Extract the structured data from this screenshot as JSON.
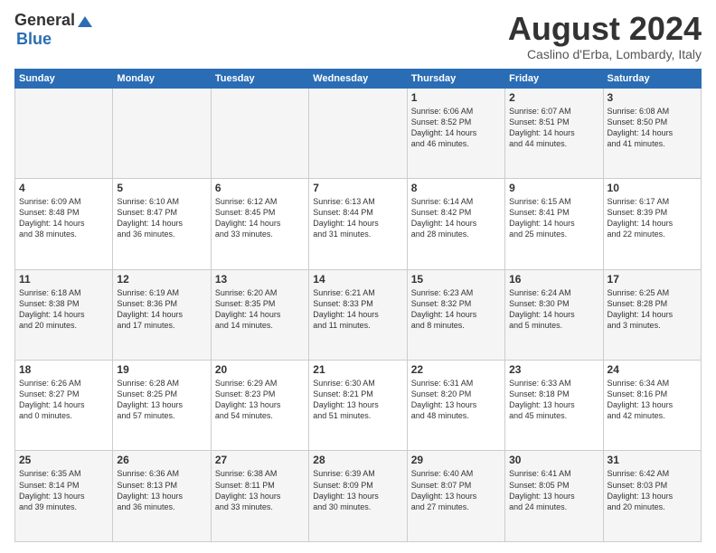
{
  "logo": {
    "general": "General",
    "blue": "Blue"
  },
  "header": {
    "month": "August 2024",
    "location": "Caslino d'Erba, Lombardy, Italy"
  },
  "days_of_week": [
    "Sunday",
    "Monday",
    "Tuesday",
    "Wednesday",
    "Thursday",
    "Friday",
    "Saturday"
  ],
  "weeks": [
    [
      {
        "day": "",
        "content": ""
      },
      {
        "day": "",
        "content": ""
      },
      {
        "day": "",
        "content": ""
      },
      {
        "day": "",
        "content": ""
      },
      {
        "day": "1",
        "content": "Sunrise: 6:06 AM\nSunset: 8:52 PM\nDaylight: 14 hours\nand 46 minutes."
      },
      {
        "day": "2",
        "content": "Sunrise: 6:07 AM\nSunset: 8:51 PM\nDaylight: 14 hours\nand 44 minutes."
      },
      {
        "day": "3",
        "content": "Sunrise: 6:08 AM\nSunset: 8:50 PM\nDaylight: 14 hours\nand 41 minutes."
      }
    ],
    [
      {
        "day": "4",
        "content": "Sunrise: 6:09 AM\nSunset: 8:48 PM\nDaylight: 14 hours\nand 38 minutes."
      },
      {
        "day": "5",
        "content": "Sunrise: 6:10 AM\nSunset: 8:47 PM\nDaylight: 14 hours\nand 36 minutes."
      },
      {
        "day": "6",
        "content": "Sunrise: 6:12 AM\nSunset: 8:45 PM\nDaylight: 14 hours\nand 33 minutes."
      },
      {
        "day": "7",
        "content": "Sunrise: 6:13 AM\nSunset: 8:44 PM\nDaylight: 14 hours\nand 31 minutes."
      },
      {
        "day": "8",
        "content": "Sunrise: 6:14 AM\nSunset: 8:42 PM\nDaylight: 14 hours\nand 28 minutes."
      },
      {
        "day": "9",
        "content": "Sunrise: 6:15 AM\nSunset: 8:41 PM\nDaylight: 14 hours\nand 25 minutes."
      },
      {
        "day": "10",
        "content": "Sunrise: 6:17 AM\nSunset: 8:39 PM\nDaylight: 14 hours\nand 22 minutes."
      }
    ],
    [
      {
        "day": "11",
        "content": "Sunrise: 6:18 AM\nSunset: 8:38 PM\nDaylight: 14 hours\nand 20 minutes."
      },
      {
        "day": "12",
        "content": "Sunrise: 6:19 AM\nSunset: 8:36 PM\nDaylight: 14 hours\nand 17 minutes."
      },
      {
        "day": "13",
        "content": "Sunrise: 6:20 AM\nSunset: 8:35 PM\nDaylight: 14 hours\nand 14 minutes."
      },
      {
        "day": "14",
        "content": "Sunrise: 6:21 AM\nSunset: 8:33 PM\nDaylight: 14 hours\nand 11 minutes."
      },
      {
        "day": "15",
        "content": "Sunrise: 6:23 AM\nSunset: 8:32 PM\nDaylight: 14 hours\nand 8 minutes."
      },
      {
        "day": "16",
        "content": "Sunrise: 6:24 AM\nSunset: 8:30 PM\nDaylight: 14 hours\nand 5 minutes."
      },
      {
        "day": "17",
        "content": "Sunrise: 6:25 AM\nSunset: 8:28 PM\nDaylight: 14 hours\nand 3 minutes."
      }
    ],
    [
      {
        "day": "18",
        "content": "Sunrise: 6:26 AM\nSunset: 8:27 PM\nDaylight: 14 hours\nand 0 minutes."
      },
      {
        "day": "19",
        "content": "Sunrise: 6:28 AM\nSunset: 8:25 PM\nDaylight: 13 hours\nand 57 minutes."
      },
      {
        "day": "20",
        "content": "Sunrise: 6:29 AM\nSunset: 8:23 PM\nDaylight: 13 hours\nand 54 minutes."
      },
      {
        "day": "21",
        "content": "Sunrise: 6:30 AM\nSunset: 8:21 PM\nDaylight: 13 hours\nand 51 minutes."
      },
      {
        "day": "22",
        "content": "Sunrise: 6:31 AM\nSunset: 8:20 PM\nDaylight: 13 hours\nand 48 minutes."
      },
      {
        "day": "23",
        "content": "Sunrise: 6:33 AM\nSunset: 8:18 PM\nDaylight: 13 hours\nand 45 minutes."
      },
      {
        "day": "24",
        "content": "Sunrise: 6:34 AM\nSunset: 8:16 PM\nDaylight: 13 hours\nand 42 minutes."
      }
    ],
    [
      {
        "day": "25",
        "content": "Sunrise: 6:35 AM\nSunset: 8:14 PM\nDaylight: 13 hours\nand 39 minutes."
      },
      {
        "day": "26",
        "content": "Sunrise: 6:36 AM\nSunset: 8:13 PM\nDaylight: 13 hours\nand 36 minutes."
      },
      {
        "day": "27",
        "content": "Sunrise: 6:38 AM\nSunset: 8:11 PM\nDaylight: 13 hours\nand 33 minutes."
      },
      {
        "day": "28",
        "content": "Sunrise: 6:39 AM\nSunset: 8:09 PM\nDaylight: 13 hours\nand 30 minutes."
      },
      {
        "day": "29",
        "content": "Sunrise: 6:40 AM\nSunset: 8:07 PM\nDaylight: 13 hours\nand 27 minutes."
      },
      {
        "day": "30",
        "content": "Sunrise: 6:41 AM\nSunset: 8:05 PM\nDaylight: 13 hours\nand 24 minutes."
      },
      {
        "day": "31",
        "content": "Sunrise: 6:42 AM\nSunset: 8:03 PM\nDaylight: 13 hours\nand 20 minutes."
      }
    ]
  ]
}
